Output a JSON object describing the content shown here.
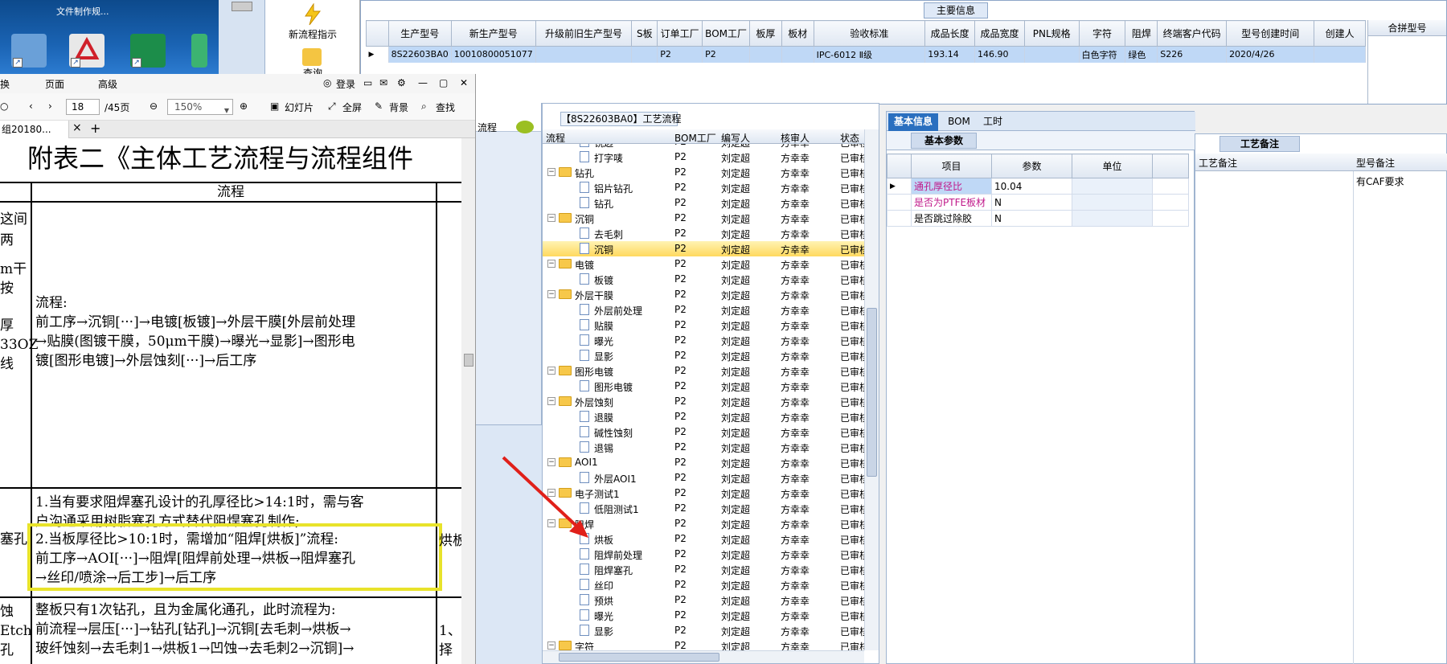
{
  "desktop": {
    "caption": "文件制作规..."
  },
  "tool_pane": {
    "new_process": "新流程指示",
    "query": "查询"
  },
  "main_info": {
    "section_title": "主要信息",
    "columns": [
      "生产型号",
      "新生产型号",
      "升级前旧生产型号",
      "S板",
      "订单工厂",
      "BOM工厂",
      "板厚",
      "板材",
      "验收标准",
      "成品长度",
      "成品宽度",
      "PNL规格",
      "字符",
      "阻焊",
      "终端客户代码",
      "型号创建时间",
      "创建人"
    ],
    "row": [
      "8S22603BA0",
      "10010800051077",
      "",
      "",
      "P2",
      "P2",
      "",
      "",
      "IPC-6012 Ⅱ级",
      "193.14",
      "146.90",
      "",
      "白色字符",
      "绿色",
      "S226",
      "2020/4/26",
      ""
    ],
    "merge_header": "合拼型号"
  },
  "pdf": {
    "menu": [
      "换",
      "页面",
      "高级"
    ],
    "login": "登录",
    "page_current": "18",
    "page_total": "/45页",
    "zoom": "150%",
    "slideshow": "幻灯片",
    "fullscreen": "全屏",
    "background": "背景",
    "find": "查找",
    "tab_name": "组20180...",
    "doc_title": "附表二《主体工艺流程与流程组件",
    "col_header": "流程",
    "left_frag": [
      "这间",
      "两",
      "m干",
      "按",
      "厚",
      "33OZ",
      "线",
      "塞孔",
      "蚀",
      "Etch",
      "孔"
    ],
    "cell1": [
      "流程:",
      "前工序→沉铜[···]→电镀[板镀]→外层干膜[外层前处理",
      "→贴膜(图镀干膜，50μm干膜)→曝光→显影]→图形电",
      "镀[图形电镀]→外层蚀刻[···]→后工序"
    ],
    "cell2": [
      "1.当有要求阻焊塞孔设计的孔厚径比>14:1时，需与客",
      "户沟通采用树脂塞孔方式替代阻焊塞孔制作;"
    ],
    "cell2_highlight": [
      "2.当板厚径比>10:1时，需增加“阻焊[烘板]”流程:",
      "前工序→AOI[···]→阻焊[阻焊前处理→烘板→阻焊塞孔",
      "→丝印/喷涂→后工步]→后工序"
    ],
    "cell3": [
      "整板只有1次钻孔，且为金属化通孔，此时流程为:",
      "前流程→层压[···]→钻孔[钻孔]→沉铜[去毛刺→烘板→",
      "玻纤蚀刻→去毛刺1→烘板1→凹蚀→去毛刺2→沉铜]→"
    ],
    "right_frag": [
      "烘板",
      "1、",
      "择"
    ]
  },
  "process": {
    "left_header": "流程",
    "title": "【8S22603BA0】工艺流程",
    "columns": [
      "流程",
      "BOM工厂",
      "编写人",
      "核审人",
      "状态"
    ],
    "rows": [
      {
        "level": 1,
        "type": "doc",
        "name": "铣边",
        "bom": "P2",
        "author": "刘定超",
        "reviewer": "方幸幸",
        "status": "已审核"
      },
      {
        "level": 1,
        "type": "doc",
        "name": "打字唛",
        "bom": "P2",
        "author": "刘定超",
        "reviewer": "方幸幸",
        "status": "已审核"
      },
      {
        "level": 0,
        "type": "folder",
        "name": "钻孔",
        "bom": "P2",
        "author": "刘定超",
        "reviewer": "方幸幸",
        "status": "已审核"
      },
      {
        "level": 1,
        "type": "doc",
        "name": "铝片钻孔",
        "bom": "P2",
        "author": "刘定超",
        "reviewer": "方幸幸",
        "status": "已审核"
      },
      {
        "level": 1,
        "type": "doc",
        "name": "钻孔",
        "bom": "P2",
        "author": "刘定超",
        "reviewer": "方幸幸",
        "status": "已审核"
      },
      {
        "level": 0,
        "type": "folder",
        "name": "沉铜",
        "bom": "P2",
        "author": "刘定超",
        "reviewer": "方幸幸",
        "status": "已审核"
      },
      {
        "level": 1,
        "type": "doc",
        "name": "去毛刺",
        "bom": "P2",
        "author": "刘定超",
        "reviewer": "方幸幸",
        "status": "已审核"
      },
      {
        "level": 1,
        "type": "doc",
        "name": "沉铜",
        "bom": "P2",
        "author": "刘定超",
        "reviewer": "方幸幸",
        "status": "已审核",
        "selected": true
      },
      {
        "level": 0,
        "type": "folder",
        "name": "电镀",
        "bom": "P2",
        "author": "刘定超",
        "reviewer": "方幸幸",
        "status": "已审核"
      },
      {
        "level": 1,
        "type": "doc",
        "name": "板镀",
        "bom": "P2",
        "author": "刘定超",
        "reviewer": "方幸幸",
        "status": "已审核"
      },
      {
        "level": 0,
        "type": "folder",
        "name": "外层干膜",
        "bom": "P2",
        "author": "刘定超",
        "reviewer": "方幸幸",
        "status": "已审核"
      },
      {
        "level": 1,
        "type": "doc",
        "name": "外层前处理",
        "bom": "P2",
        "author": "刘定超",
        "reviewer": "方幸幸",
        "status": "已审核"
      },
      {
        "level": 1,
        "type": "doc",
        "name": "贴膜",
        "bom": "P2",
        "author": "刘定超",
        "reviewer": "方幸幸",
        "status": "已审核"
      },
      {
        "level": 1,
        "type": "doc",
        "name": "曝光",
        "bom": "P2",
        "author": "刘定超",
        "reviewer": "方幸幸",
        "status": "已审核"
      },
      {
        "level": 1,
        "type": "doc",
        "name": "显影",
        "bom": "P2",
        "author": "刘定超",
        "reviewer": "方幸幸",
        "status": "已审核"
      },
      {
        "level": 0,
        "type": "folder",
        "name": "图形电镀",
        "bom": "P2",
        "author": "刘定超",
        "reviewer": "方幸幸",
        "status": "已审核"
      },
      {
        "level": 1,
        "type": "doc",
        "name": "图形电镀",
        "bom": "P2",
        "author": "刘定超",
        "reviewer": "方幸幸",
        "status": "已审核"
      },
      {
        "level": 0,
        "type": "folder",
        "name": "外层蚀刻",
        "bom": "P2",
        "author": "刘定超",
        "reviewer": "方幸幸",
        "status": "已审核"
      },
      {
        "level": 1,
        "type": "doc",
        "name": "退膜",
        "bom": "P2",
        "author": "刘定超",
        "reviewer": "方幸幸",
        "status": "已审核"
      },
      {
        "level": 1,
        "type": "doc",
        "name": "碱性蚀刻",
        "bom": "P2",
        "author": "刘定超",
        "reviewer": "方幸幸",
        "status": "已审核"
      },
      {
        "level": 1,
        "type": "doc",
        "name": "退锡",
        "bom": "P2",
        "author": "刘定超",
        "reviewer": "方幸幸",
        "status": "已审核"
      },
      {
        "level": 0,
        "type": "folder",
        "name": "AOI1",
        "bom": "P2",
        "author": "刘定超",
        "reviewer": "方幸幸",
        "status": "已审核"
      },
      {
        "level": 1,
        "type": "doc",
        "name": "外层AOI1",
        "bom": "P2",
        "author": "刘定超",
        "reviewer": "方幸幸",
        "status": "已审核"
      },
      {
        "level": 0,
        "type": "folder",
        "name": "电子测试1",
        "bom": "P2",
        "author": "刘定超",
        "reviewer": "方幸幸",
        "status": "已审核"
      },
      {
        "level": 1,
        "type": "doc",
        "name": "低阻测试1",
        "bom": "P2",
        "author": "刘定超",
        "reviewer": "方幸幸",
        "status": "已审核"
      },
      {
        "level": 0,
        "type": "folder",
        "name": "阻焊",
        "bom": "P2",
        "author": "刘定超",
        "reviewer": "方幸幸",
        "status": "已审核"
      },
      {
        "level": 1,
        "type": "doc",
        "name": "烘板",
        "bom": "P2",
        "author": "刘定超",
        "reviewer": "方幸幸",
        "status": "已审核"
      },
      {
        "level": 1,
        "type": "doc",
        "name": "阻焊前处理",
        "bom": "P2",
        "author": "刘定超",
        "reviewer": "方幸幸",
        "status": "已审核"
      },
      {
        "level": 1,
        "type": "doc",
        "name": "阻焊塞孔",
        "bom": "P2",
        "author": "刘定超",
        "reviewer": "方幸幸",
        "status": "已审核"
      },
      {
        "level": 1,
        "type": "doc",
        "name": "丝印",
        "bom": "P2",
        "author": "刘定超",
        "reviewer": "方幸幸",
        "status": "已审核"
      },
      {
        "level": 1,
        "type": "doc",
        "name": "预烘",
        "bom": "P2",
        "author": "刘定超",
        "reviewer": "方幸幸",
        "status": "已审核"
      },
      {
        "level": 1,
        "type": "doc",
        "name": "曝光",
        "bom": "P2",
        "author": "刘定超",
        "reviewer": "方幸幸",
        "status": "已审核"
      },
      {
        "level": 1,
        "type": "doc",
        "name": "显影",
        "bom": "P2",
        "author": "刘定超",
        "reviewer": "方幸幸",
        "status": "已审核"
      },
      {
        "level": 0,
        "type": "folder",
        "name": "字符",
        "bom": "P2",
        "author": "刘定超",
        "reviewer": "方幸幸",
        "status": "已审核"
      }
    ]
  },
  "basic_info": {
    "tabs": [
      "基本信息",
      "BOM",
      "工时"
    ],
    "sub_tab": "基本参数",
    "columns": [
      "项目",
      "参数",
      "单位"
    ],
    "rows": [
      {
        "name": "通孔厚径比",
        "value": "10.04",
        "unit": ""
      },
      {
        "name": "是否为PTFE板材",
        "value": "N",
        "unit": ""
      },
      {
        "name": "是否跳过除胶",
        "value": "N",
        "unit": ""
      }
    ]
  },
  "notes": {
    "tab": "工艺备注",
    "columns": [
      "工艺备注",
      "型号备注"
    ],
    "model_note": "有CAF要求"
  }
}
